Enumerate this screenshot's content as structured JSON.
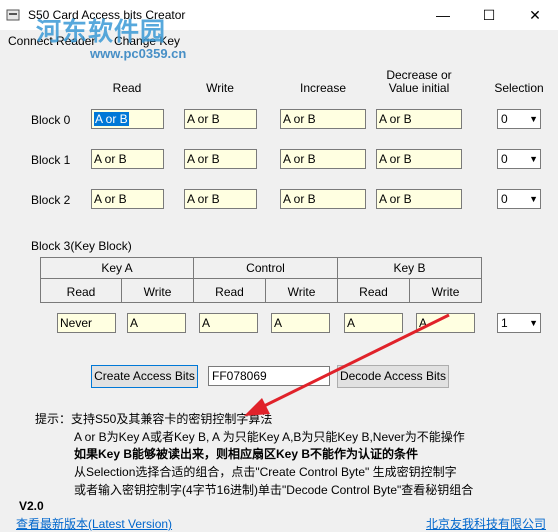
{
  "window": {
    "title": "S50 Card Access bits Creator"
  },
  "watermark": {
    "line1": "河东软件园",
    "line2": "www.pc0359.cn"
  },
  "menu": {
    "connect_reader": "Connect Reader",
    "change_key": "Change Key"
  },
  "data_blocks": {
    "headers": {
      "read": "Read",
      "write": "Write",
      "increase": "Increase",
      "decrease_line1": "Decrease or",
      "decrease_line2": "Value initial",
      "selection": "Selection"
    },
    "rows": [
      {
        "label": "Block 0",
        "read": "A or B",
        "write": "A or B",
        "increase": "A or B",
        "decrease": "A or B",
        "selection": "0"
      },
      {
        "label": "Block 1",
        "read": "A or B",
        "write": "A or B",
        "increase": "A or B",
        "decrease": "A or B",
        "selection": "0"
      },
      {
        "label": "Block 2",
        "read": "A or B",
        "write": "A or B",
        "increase": "A or B",
        "decrease": "A or B",
        "selection": "0"
      }
    ]
  },
  "key_block": {
    "title": "Block 3(Key Block)",
    "groups": {
      "key_a": "Key A",
      "control": "Control",
      "key_b": "Key B"
    },
    "sub": {
      "read": "Read",
      "write": "Write"
    },
    "values": {
      "key_a_read": "Never",
      "key_a_write": "A",
      "control_read": "A",
      "control_write": "A",
      "key_b_read": "A",
      "key_b_write": "A",
      "selection": "1"
    }
  },
  "actions": {
    "create": "Create Access Bits",
    "control_byte": "FF078069",
    "decode": "Decode Access Bits"
  },
  "hints": {
    "line1": "提示：支持S50及其兼容卡的密钥控制字算法",
    "line2": "A or B为Key A或者Key B, A 为只能Key A,B为只能Key B,Never为不能操作",
    "line3": "如果Key B能够被读出来，则相应扇区Key B不能作为认证的条件",
    "line4": "从Selection选择合适的组合，点击\"Create Control Byte\" 生成密钥控制字",
    "line5": "或者输入密钥控制字(4字节16进制)单击\"Decode Control Byte\"查看秘钥组合"
  },
  "footer": {
    "version": "V2.0",
    "update_link": "查看最新版本(Latest Version)",
    "company_link": "北京友我科技有限公司"
  },
  "colors": {
    "field_bg": "#ffffe1",
    "arrow": "#e0222a",
    "link": "#0066cc",
    "watermark": "#3a9ad6"
  }
}
